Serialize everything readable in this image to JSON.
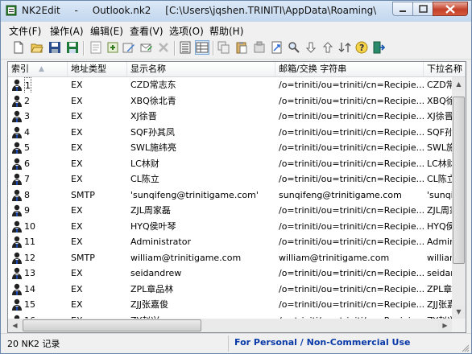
{
  "window": {
    "app_name": "NK2Edit",
    "dash": "-",
    "file_name": "Outlook.nk2",
    "path": "[C:\\Users\\jqshen.TRINITI\\AppData\\Roaming\\Microsoft\\Out..."
  },
  "menu": [
    "文件(F)",
    "操作(A)",
    "编辑(E)",
    "查看(V)",
    "选项(O)",
    "帮助(H)"
  ],
  "toolbar": [
    "new-file-icon",
    "open-file-icon",
    "save-icon",
    "save-as-icon",
    "properties-icon",
    "add-contact-icon",
    "edit-contact-icon",
    "delete-icon",
    "details-view-icon",
    "list-view-icon",
    "copy-icon",
    "paste-icon",
    "paste-special-icon",
    "export-icon",
    "find-icon",
    "move-down-icon",
    "move-up-icon",
    "sort-icon",
    "help-icon",
    "exit-icon"
  ],
  "columns": [
    "索引",
    "地址类型",
    "显示名称",
    "邮箱/交换 字符串",
    "下拉名称"
  ],
  "rows": [
    {
      "index": "1",
      "type": "EX",
      "display": "CZD常志东",
      "email": "/o=triniti/ou=triniti/cn=Recipie...",
      "dropdown": "CZD常志"
    },
    {
      "index": "2",
      "type": "EX",
      "display": "XBQ徐北青",
      "email": "/o=triniti/ou=triniti/cn=Recipie...",
      "dropdown": "XBQ徐北"
    },
    {
      "index": "3",
      "type": "EX",
      "display": "XJ徐晋",
      "email": "/o=triniti/ou=triniti/cn=Recipie...",
      "dropdown": "XJ徐晋"
    },
    {
      "index": "4",
      "type": "EX",
      "display": "SQF孙其凤",
      "email": "/o=triniti/ou=triniti/cn=Recipie...",
      "dropdown": "SQF孙其"
    },
    {
      "index": "5",
      "type": "EX",
      "display": "SWL施纬亮",
      "email": "/o=triniti/ou=triniti/cn=Recipie...",
      "dropdown": "SWL施纬"
    },
    {
      "index": "6",
      "type": "EX",
      "display": "LC林财",
      "email": "/o=triniti/ou=triniti/cn=Recipie...",
      "dropdown": "LC林财"
    },
    {
      "index": "7",
      "type": "EX",
      "display": "CL陈立",
      "email": "/o=triniti/ou=triniti/cn=Recipie...",
      "dropdown": "CL陈立"
    },
    {
      "index": "8",
      "type": "SMTP",
      "display": "'sunqifeng@trinitigame.com'",
      "email": "sunqifeng@trinitigame.com",
      "dropdown": "'sunqif"
    },
    {
      "index": "9",
      "type": "EX",
      "display": "ZJL周家磊",
      "email": "/o=triniti/ou=triniti/cn=Recipie...",
      "dropdown": "ZJL周家"
    },
    {
      "index": "10",
      "type": "EX",
      "display": "HYQ侯叶琴",
      "email": "/o=triniti/ou=triniti/cn=Recipie...",
      "dropdown": "HYQ侯叶"
    },
    {
      "index": "11",
      "type": "EX",
      "display": "Administrator",
      "email": "/o=triniti/ou=triniti/cn=Recipie...",
      "dropdown": "Admini"
    },
    {
      "index": "12",
      "type": "SMTP",
      "display": "william@trinitigame.com",
      "email": "william@trinitigame.com",
      "dropdown": "william"
    },
    {
      "index": "13",
      "type": "EX",
      "display": "seidandrew",
      "email": "/o=triniti/ou=triniti/cn=Recipie...",
      "dropdown": "seidan"
    },
    {
      "index": "14",
      "type": "EX",
      "display": "ZPL章品林",
      "email": "/o=triniti/ou=triniti/cn=Recipie...",
      "dropdown": "ZPL章品"
    },
    {
      "index": "15",
      "type": "EX",
      "display": "ZJJ张嘉俊",
      "email": "/o=triniti/ou=triniti/cn=Recipie...",
      "dropdown": "ZJJ张嘉"
    },
    {
      "index": "16",
      "type": "EX",
      "display": "ZY赵兴",
      "email": "/o=triniti/ou=triniti/cn=Recipie...",
      "dropdown": "ZY赵兴"
    }
  ],
  "status": {
    "count": "20 NK2 记录",
    "license": "For Personal / Non-Commercial Use"
  }
}
